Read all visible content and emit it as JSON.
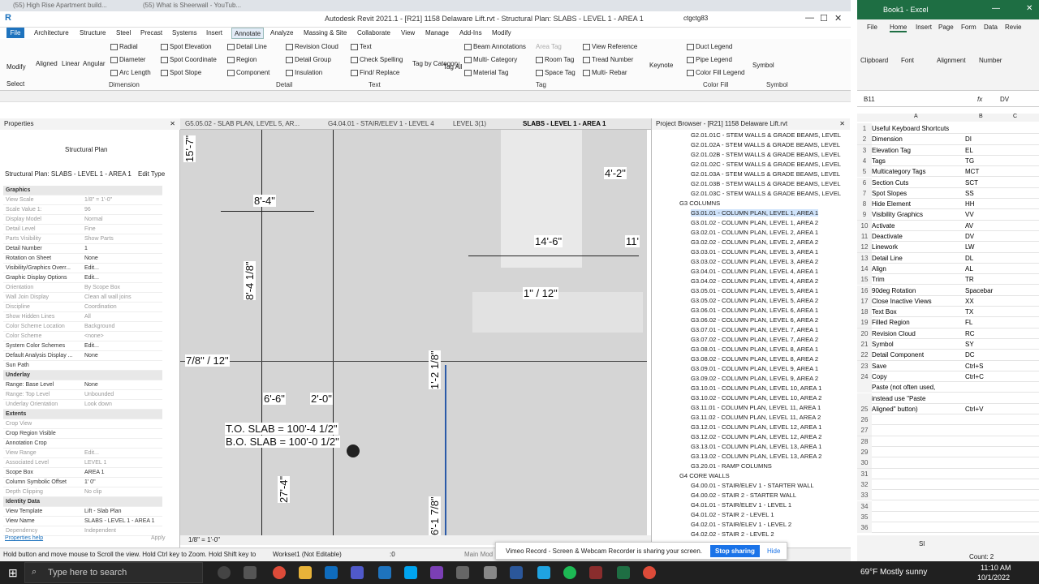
{
  "browser_tabs": [
    "(55) High Rise Apartment build...",
    "(55) What is Sheerwall - YouTub..."
  ],
  "revit": {
    "title": "Autodesk Revit 2021.1 - [R21] 1158 Delaware Lift.rvt - Structural Plan: SLABS - LEVEL 1 - AREA 1",
    "user": "ctgctg83",
    "file_label": "File",
    "menus": [
      "Architecture",
      "Structure",
      "Steel",
      "Precast",
      "Systems",
      "Insert",
      "Annotate",
      "Analyze",
      "Massing & Site",
      "Collaborate",
      "View",
      "Manage",
      "Add-Ins",
      "Modify"
    ],
    "active_menu": "Annotate",
    "ribbon": {
      "modify": "Modify",
      "select": "Select",
      "dim_tools": [
        "Aligned",
        "Linear",
        "Angular",
        "Radial",
        "Diameter",
        "Arc Length",
        "Spot Elevation",
        "Spot Coordinate",
        "Spot Slope"
      ],
      "detail_tools": [
        "Detail Line",
        "Region",
        "Component",
        "Revision Cloud",
        "Detail Group",
        "Insulation"
      ],
      "text_tools": [
        "Text",
        "Check Spelling",
        "Find/ Replace"
      ],
      "tag_tools": [
        "Tag by Category",
        "Tag All",
        "Beam Annotations",
        "Multi- Category",
        "Material Tag",
        "Area Tag",
        "Room Tag",
        "Space Tag",
        "View Reference",
        "Tread Number",
        "Multi- Rebar"
      ],
      "keynote": "Keynote",
      "color_tools": [
        "Duct Legend",
        "Pipe Legend",
        "Color Fill Legend"
      ],
      "symbol": "Symbol",
      "groups": [
        "Dimension",
        "Detail",
        "Text",
        "Tag",
        "Color Fill",
        "Symbol"
      ]
    },
    "properties": {
      "header": "Properties",
      "type": "Structural Plan",
      "instance": "Structural Plan: SLABS - LEVEL 1 - AREA 1",
      "edit_type": "Edit Type",
      "rows": [
        {
          "k": "Graphics",
          "v": "",
          "sec": true
        },
        {
          "k": "View Scale",
          "v": "1/8\" = 1'-0\"",
          "dis": true
        },
        {
          "k": "Scale Value    1:",
          "v": "96",
          "dis": true
        },
        {
          "k": "Display Model",
          "v": "Normal",
          "dis": true
        },
        {
          "k": "Detail Level",
          "v": "Fine",
          "dis": true
        },
        {
          "k": "Parts Visibility",
          "v": "Show Parts",
          "dis": true
        },
        {
          "k": "Detail Number",
          "v": "1"
        },
        {
          "k": "Rotation on Sheet",
          "v": "None"
        },
        {
          "k": "Visibility/Graphics Overr...",
          "v": "Edit..."
        },
        {
          "k": "Graphic Display Options",
          "v": "Edit..."
        },
        {
          "k": "Orientation",
          "v": "By Scope Box",
          "dis": true
        },
        {
          "k": "Wall Join Display",
          "v": "Clean all wall joins",
          "dis": true
        },
        {
          "k": "Discipline",
          "v": "Coordination",
          "dis": true
        },
        {
          "k": "Show Hidden Lines",
          "v": "All",
          "dis": true
        },
        {
          "k": "Color Scheme Location",
          "v": "Background",
          "dis": true
        },
        {
          "k": "Color Scheme",
          "v": "<none>",
          "dis": true
        },
        {
          "k": "System Color Schemes",
          "v": "Edit..."
        },
        {
          "k": "Default Analysis Display ...",
          "v": "None"
        },
        {
          "k": "Sun Path",
          "v": ""
        },
        {
          "k": "Underlay",
          "v": "",
          "sec": true
        },
        {
          "k": "Range: Base Level",
          "v": "None"
        },
        {
          "k": "Range: Top Level",
          "v": "Unbounded",
          "dis": true
        },
        {
          "k": "Underlay Orientation",
          "v": "Look down",
          "dis": true
        },
        {
          "k": "Extents",
          "v": "",
          "sec": true
        },
        {
          "k": "Crop View",
          "v": "",
          "dis": true
        },
        {
          "k": "Crop Region Visible",
          "v": ""
        },
        {
          "k": "Annotation Crop",
          "v": ""
        },
        {
          "k": "View Range",
          "v": "Edit...",
          "dis": true
        },
        {
          "k": "Associated Level",
          "v": "LEVEL 1",
          "dis": true
        },
        {
          "k": "Scope Box",
          "v": "AREA 1"
        },
        {
          "k": "Column Symbolic Offset",
          "v": "1' 0\""
        },
        {
          "k": "Depth Clipping",
          "v": "No clip",
          "dis": true
        },
        {
          "k": "Identity Data",
          "v": "",
          "sec": true
        },
        {
          "k": "View Template",
          "v": "Lift - Slab Plan"
        },
        {
          "k": "View Name",
          "v": "SLABS - LEVEL 1 - AREA 1"
        },
        {
          "k": "Dependency",
          "v": "Independent",
          "dis": true
        }
      ],
      "help": "Properties help",
      "apply": "Apply"
    },
    "view_tabs": [
      "G5.05.02 - SLAB PLAN, LEVEL 5, AR...",
      "G4.04.01 - STAIR/ELEV 1 - LEVEL 4",
      "LEVEL 3(1)",
      "SLABS - LEVEL 1 - AREA 1"
    ],
    "dims": {
      "d1": "15'-7\"",
      "d2": "8'-4\"",
      "d3": "8'-4 1/8\"",
      "d4": "4'-2\"",
      "d5": "14'-6\"",
      "d6": "11'",
      "d7": "1\" / 12\"",
      "d8": "7/8\" / 12\"",
      "d9": "1'-2 1/8\"",
      "d10": "6'-6\"",
      "d11": "2'-0\"",
      "d12": "T.O. SLAB = 100'-4 1/2\"",
      "d13": "B.O. SLAB = 100'-0 1/2\"",
      "d14": "27'-4\"",
      "d15": "6'-1 7/8\""
    },
    "view_scale": "1/8\" = 1'-0\"",
    "project_browser": {
      "header": "Project Browser - [R21] 1158 Delaware Lift.rvt",
      "items": [
        {
          "t": "G2.01.01C - STEM WALLS & GRADE BEAMS, LEVEL"
        },
        {
          "t": "G2.01.02A - STEM WALLS & GRADE BEAMS, LEVEL"
        },
        {
          "t": "G2.01.02B - STEM WALLS & GRADE BEAMS, LEVEL"
        },
        {
          "t": "G2.01.02C - STEM WALLS & GRADE BEAMS, LEVEL"
        },
        {
          "t": "G2.01.03A - STEM WALLS & GRADE BEAMS, LEVEL"
        },
        {
          "t": "G2.01.03B - STEM WALLS & GRADE BEAMS, LEVEL"
        },
        {
          "t": "G2.01.03C - STEM WALLS & GRADE BEAMS, LEVEL"
        },
        {
          "t": "G3 COLUMNS",
          "g": true
        },
        {
          "t": "G3.01.01 - COLUMN PLAN, LEVEL 1, AREA 1",
          "sel": true
        },
        {
          "t": "G3.01.02 - COLUMN PLAN, LEVEL 1, AREA 2"
        },
        {
          "t": "G3.02.01 - COLUMN PLAN, LEVEL 2, AREA 1"
        },
        {
          "t": "G3.02.02 - COLUMN PLAN, LEVEL 2, AREA 2"
        },
        {
          "t": "G3.03.01 - COLUMN PLAN, LEVEL 3, AREA 1"
        },
        {
          "t": "G3.03.02 - COLUMN PLAN, LEVEL 3, AREA 2"
        },
        {
          "t": "G3.04.01 - COLUMN PLAN, LEVEL 4, AREA 1"
        },
        {
          "t": "G3.04.02 - COLUMN PLAN, LEVEL 4, AREA 2"
        },
        {
          "t": "G3.05.01 - COLUMN PLAN, LEVEL 5, AREA 1"
        },
        {
          "t": "G3.05.02 - COLUMN PLAN, LEVEL 5, AREA 2"
        },
        {
          "t": "G3.06.01 - COLUMN PLAN, LEVEL 6, AREA 1"
        },
        {
          "t": "G3.06.02 - COLUMN PLAN, LEVEL 6, AREA 2"
        },
        {
          "t": "G3.07.01 - COLUMN PLAN, LEVEL 7, AREA 1"
        },
        {
          "t": "G3.07.02 - COLUMN PLAN, LEVEL 7, AREA 2"
        },
        {
          "t": "G3.08.01 - COLUMN PLAN, LEVEL 8, AREA 1"
        },
        {
          "t": "G3.08.02 - COLUMN PLAN, LEVEL 8, AREA 2"
        },
        {
          "t": "G3.09.01 - COLUMN PLAN, LEVEL 9, AREA 1"
        },
        {
          "t": "G3.09.02 - COLUMN PLAN, LEVEL 9, AREA 2"
        },
        {
          "t": "G3.10.01 - COLUMN PLAN, LEVEL 10, AREA 1"
        },
        {
          "t": "G3.10.02 - COLUMN PLAN, LEVEL 10, AREA 2"
        },
        {
          "t": "G3.11.01 - COLUMN PLAN, LEVEL 11, AREA 1"
        },
        {
          "t": "G3.11.02 - COLUMN PLAN, LEVEL 11, AREA 2"
        },
        {
          "t": "G3.12.01 - COLUMN PLAN, LEVEL 12, AREA 1"
        },
        {
          "t": "G3.12.02 - COLUMN PLAN, LEVEL 12, AREA 2"
        },
        {
          "t": "G3.13.01 - COLUMN PLAN, LEVEL 13, AREA 1"
        },
        {
          "t": "G3.13.02 - COLUMN PLAN, LEVEL 13, AREA 2"
        },
        {
          "t": "G3.20.01 - RAMP COLUMNS"
        },
        {
          "t": "G4 CORE WALLS",
          "g": true
        },
        {
          "t": "G4.00.01 - STAIR/ELEV 1 - STARTER WALL"
        },
        {
          "t": "G4.00.02 - STAIR 2 - STARTER WALL"
        },
        {
          "t": "G4.01.01 - STAIR/ELEV 1 - LEVEL 1"
        },
        {
          "t": "G4.01.02 - STAIR 2 - LEVEL 1"
        },
        {
          "t": "G4.02.01 - STAIR/ELEV 1 - LEVEL 2"
        },
        {
          "t": "G4.02.02 - STAIR 2 - LEVEL 2"
        }
      ]
    },
    "status": "Hold button and move mouse to Scroll the view. Hold Ctrl key to Zoom. Hold Shift key to",
    "workset": "Workset1 (Not Editable)",
    "main_model": "Main Mod",
    "count_zero": ":0"
  },
  "toast": {
    "text": "Vimeo Record - Screen & Webcam Recorder is sharing your screen.",
    "stop": "Stop sharing",
    "hide": "Hide"
  },
  "excel": {
    "title": "Book1 - Excel",
    "tabs": [
      "File",
      "Home",
      "Insert",
      "Page",
      "Form",
      "Data",
      "Revie"
    ],
    "groups": [
      "Clipboard",
      "Font",
      "Alignment",
      "Number"
    ],
    "namebox": "B11",
    "fx": "fx",
    "formula_val": "DV",
    "col_headers": [
      "A",
      "B",
      "C"
    ],
    "rows": [
      {
        "n": "1",
        "a": "Useful Keyboard Shortcuts",
        "b": ""
      },
      {
        "n": "2",
        "a": "Dimension",
        "b": "DI"
      },
      {
        "n": "3",
        "a": "Elevation Tag",
        "b": "EL"
      },
      {
        "n": "4",
        "a": "Tags",
        "b": "TG"
      },
      {
        "n": "5",
        "a": "Multicategory Tags",
        "b": "MCT"
      },
      {
        "n": "6",
        "a": "Section Cuts",
        "b": "SCT"
      },
      {
        "n": "7",
        "a": "Spot Slopes",
        "b": "SS"
      },
      {
        "n": "8",
        "a": "Hide Element",
        "b": "HH"
      },
      {
        "n": "9",
        "a": "Visibility Graphics",
        "b": "VV"
      },
      {
        "n": "10",
        "a": "Activate",
        "b": "AV"
      },
      {
        "n": "11",
        "a": "Deactivate",
        "b": "DV"
      },
      {
        "n": "12",
        "a": "Linework",
        "b": "LW"
      },
      {
        "n": "13",
        "a": "Detail Line",
        "b": "DL"
      },
      {
        "n": "14",
        "a": "Align",
        "b": "AL"
      },
      {
        "n": "15",
        "a": "Trim",
        "b": "TR"
      },
      {
        "n": "16",
        "a": "90deg Rotation",
        "b": "Spacebar"
      },
      {
        "n": "17",
        "a": "Close Inactive Views",
        "b": "XX"
      },
      {
        "n": "18",
        "a": "Text Box",
        "b": "TX"
      },
      {
        "n": "19",
        "a": "Filled Region",
        "b": "FL"
      },
      {
        "n": "20",
        "a": "Revision Cloud",
        "b": "RC"
      },
      {
        "n": "21",
        "a": "Symbol",
        "b": "SY"
      },
      {
        "n": "22",
        "a": "Detail Component",
        "b": "DC"
      },
      {
        "n": "23",
        "a": "Save",
        "b": "Ctrl+S"
      },
      {
        "n": "24",
        "a": "Copy",
        "b": "Ctrl+C"
      },
      {
        "n": "",
        "a": "Paste (not often used,",
        "b": ""
      },
      {
        "n": "",
        "a": "instead use \"Paste",
        "b": ""
      },
      {
        "n": "25",
        "a": "Aligned\" button)",
        "b": "Ctrl+V"
      },
      {
        "n": "26",
        "a": "",
        "b": ""
      },
      {
        "n": "27",
        "a": "",
        "b": ""
      },
      {
        "n": "28",
        "a": "",
        "b": ""
      },
      {
        "n": "29",
        "a": "",
        "b": ""
      },
      {
        "n": "30",
        "a": "",
        "b": ""
      },
      {
        "n": "31",
        "a": "",
        "b": ""
      },
      {
        "n": "32",
        "a": "",
        "b": ""
      },
      {
        "n": "33",
        "a": "",
        "b": ""
      },
      {
        "n": "34",
        "a": "",
        "b": ""
      },
      {
        "n": "35",
        "a": "",
        "b": ""
      },
      {
        "n": "36",
        "a": "",
        "b": ""
      }
    ],
    "sheet": "Sl",
    "count": "Count: 2"
  },
  "taskbar": {
    "search": "Type here to search",
    "weather": "69°F  Mostly sunny",
    "time": "11:10 AM",
    "date": "10/1/2022"
  }
}
